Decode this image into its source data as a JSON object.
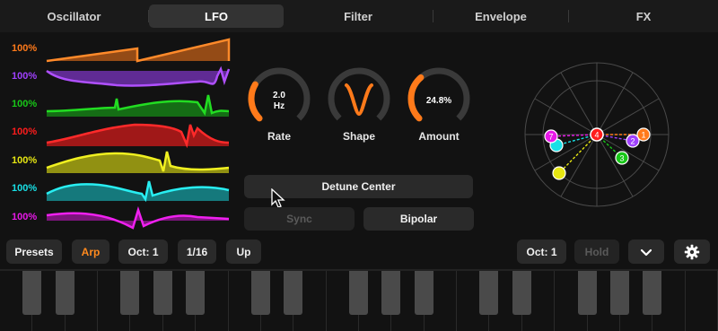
{
  "tabs": [
    "Oscillator",
    "LFO",
    "Filter",
    "Envelope",
    "FX"
  ],
  "active_tab": "LFO",
  "lfos": [
    {
      "level": "100%",
      "color": "#ff7a1a"
    },
    {
      "level": "100%",
      "color": "#a040ff"
    },
    {
      "level": "100%",
      "color": "#18c818"
    },
    {
      "level": "100%",
      "color": "#ff1c1c"
    },
    {
      "level": "100%",
      "color": "#e6e612"
    },
    {
      "level": "100%",
      "color": "#18e0e6"
    },
    {
      "level": "100%",
      "color": "#e818e8"
    }
  ],
  "knobs": {
    "rate": {
      "value_line1": "2.0",
      "value_line2": "Hz",
      "label": "Rate",
      "fraction": 0.28
    },
    "shape": {
      "label": "Shape"
    },
    "amount": {
      "value": "24.8%",
      "label": "Amount",
      "fraction": 0.35
    }
  },
  "buttons": {
    "detune": "Detune Center",
    "sync": "Sync",
    "bipolar": "Bipolar"
  },
  "radar": {
    "center_label": "4",
    "points": [
      {
        "label": "1",
        "color": "#ff7a1a"
      },
      {
        "label": "2",
        "color": "#a040ff"
      },
      {
        "label": "3",
        "color": "#18c818"
      },
      {
        "label": "7",
        "color": "#e818e8"
      },
      {
        "label": "",
        "color": "#18e0e6"
      },
      {
        "label": "",
        "color": "#e6e612"
      }
    ]
  },
  "bottom": {
    "presets": "Presets",
    "arp": "Arp",
    "oct_left": "Oct: 1",
    "rate": "1/16",
    "direction": "Up",
    "oct_right": "Oct: 1",
    "hold": "Hold"
  },
  "icons": {
    "chevron": "chevron-down-icon",
    "settings": "gear-icon",
    "cursor": "pointer-cursor-icon"
  }
}
